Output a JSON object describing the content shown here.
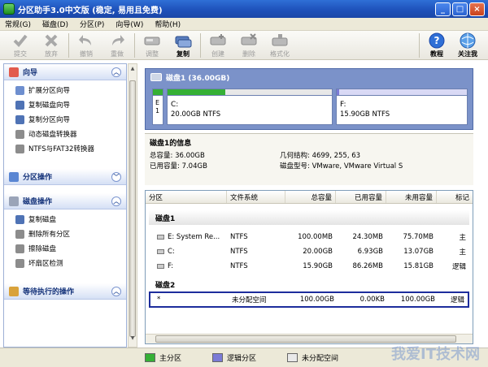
{
  "window": {
    "title": "分区助手3.0中文版 (稳定, 易用且免费)",
    "min": "_",
    "max": "□",
    "close": "×"
  },
  "menu": [
    "常规(G)",
    "磁盘(D)",
    "分区(P)",
    "向导(W)",
    "帮助(H)"
  ],
  "toolbar": {
    "submit": "提交",
    "discard": "放弃",
    "undo": "撤销",
    "redo": "重做",
    "adjust": "调整",
    "copy": "复制",
    "create": "创建",
    "delete": "删除",
    "format": "格式化",
    "tutorial": "教程",
    "follow": "关注我"
  },
  "sidebar": {
    "wizard": {
      "title": "向导",
      "items": [
        "扩展分区向导",
        "复制磁盘向导",
        "复制分区向导",
        "动态磁盘转换器",
        "NTFS与FAT32转换器"
      ]
    },
    "partition_ops": {
      "title": "分区操作"
    },
    "disk_ops": {
      "title": "磁盘操作",
      "items": [
        "复制磁盘",
        "删除所有分区",
        "擦除磁盘",
        "坏扇区检测"
      ]
    },
    "pending": {
      "title": "等待执行的操作"
    }
  },
  "disk_map": {
    "title": "磁盘1 (36.00GB)",
    "sys_letter": "E",
    "sys_num": "1",
    "c_name": "C:",
    "c_size": "20.00GB NTFS",
    "f_name": "F:",
    "f_size": "15.90GB NTFS",
    "c_used_fraction": 0.35,
    "f_used_fraction": 0.02
  },
  "info": {
    "title": "磁盘1的信息",
    "total": "总容量: 36.00GB",
    "used": "已用容量: 7.04GB",
    "geometry": "几何结构: 4699, 255, 63",
    "model": "磁盘型号: VMware, VMware Virtual S"
  },
  "table": {
    "headers": [
      "分区",
      "文件系统",
      "总容量",
      "已用容量",
      "未用容量",
      "标记"
    ],
    "disk1": "磁盘1",
    "disk2": "磁盘2",
    "rows1": [
      [
        "E:  System Re...",
        "NTFS",
        "100.00MB",
        "24.30MB",
        "75.70MB",
        "主"
      ],
      [
        "C:",
        "NTFS",
        "20.00GB",
        "6.93GB",
        "13.07GB",
        "主"
      ],
      [
        "F:",
        "NTFS",
        "15.90GB",
        "86.26MB",
        "15.81GB",
        "逻辑"
      ]
    ],
    "row2": [
      "*",
      "未分配空间",
      "100.00GB",
      "0.00KB",
      "100.00GB",
      "逻辑"
    ]
  },
  "legend": {
    "primary": "主分区",
    "logical": "逻辑分区",
    "unallocated": "未分配空间"
  },
  "colors": {
    "primary": "#35b035",
    "logical": "#7b7bd6",
    "unallocated": "#e9e9e9"
  },
  "watermark": "我爱IT技术网"
}
